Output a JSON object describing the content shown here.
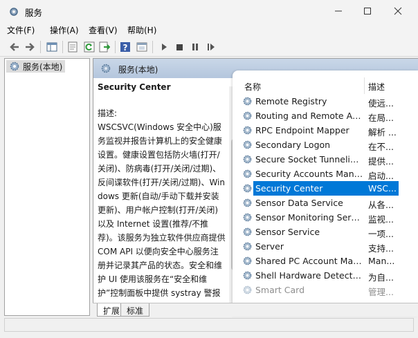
{
  "window": {
    "title": "服务"
  },
  "menu": [
    "文件(F)",
    "操作(A)",
    "查看(V)",
    "帮助(H)"
  ],
  "toolbar": {
    "icons": [
      "back-arrow-icon",
      "forward-arrow-icon",
      "console-tree-icon",
      "properties-sheet-icon",
      "refresh-icon",
      "export-list-icon",
      "help-icon",
      "view-icon",
      "play-icon",
      "stop-icon",
      "pause-icon",
      "restart-icon"
    ]
  },
  "tree": {
    "root_label": "服务(本地)"
  },
  "banner": {
    "title": "服务(本地)"
  },
  "details": {
    "service_name": "Security Center",
    "desc_label": "描述:",
    "description": "WSCSVC(Windows 安全中心)服务监视并报告计算机上的安全健康设置。健康设置包括防火墙(打开/关闭)、防病毒(打开/关闭/过期)、反间谍软件(打开/关闭/过期)、Windows 更新(自动/手动下载并安装更新)、用户帐户控制(打开/关闭)以及 Internet 设置(推荐/不推荐)。该服务为独立软件供应商提供 COM API 以便向安全中心服务注册并记录其产品的状态。安全和维护 UI 使用该服务在“安全和维护”控制面板中提供 systray 警报和安全健康状况的图形视图。网络访问保护(NAP)使用该服务向 NAP 网络策略服务器报告客户端的安全"
  },
  "list": {
    "col_name": "名称",
    "col_desc": "描述",
    "rows": [
      {
        "name": "Remote Registry",
        "desc": "使远..."
      },
      {
        "name": "Routing and Remote Acc...",
        "desc": "在局..."
      },
      {
        "name": "RPC Endpoint Mapper",
        "desc": "解析 ..."
      },
      {
        "name": "Secondary Logon",
        "desc": "在不..."
      },
      {
        "name": "Secure Socket Tunneling ...",
        "desc": "提供..."
      },
      {
        "name": "Security Accounts Manag...",
        "desc": "启动..."
      },
      {
        "name": "Security Center",
        "desc": "WSC..."
      },
      {
        "name": "Sensor Data Service",
        "desc": "从各..."
      },
      {
        "name": "Sensor Monitoring Service",
        "desc": "监视..."
      },
      {
        "name": "Sensor Service",
        "desc": "一项..."
      },
      {
        "name": "Server",
        "desc": "支持..."
      },
      {
        "name": "Shared PC Account Mana...",
        "desc": "Man..."
      },
      {
        "name": "Shell Hardware Detection",
        "desc": "为自..."
      },
      {
        "name": "Smart Card",
        "desc": "管理..."
      }
    ],
    "selected_index": 6
  },
  "tabs": [
    "扩展",
    "标准"
  ]
}
